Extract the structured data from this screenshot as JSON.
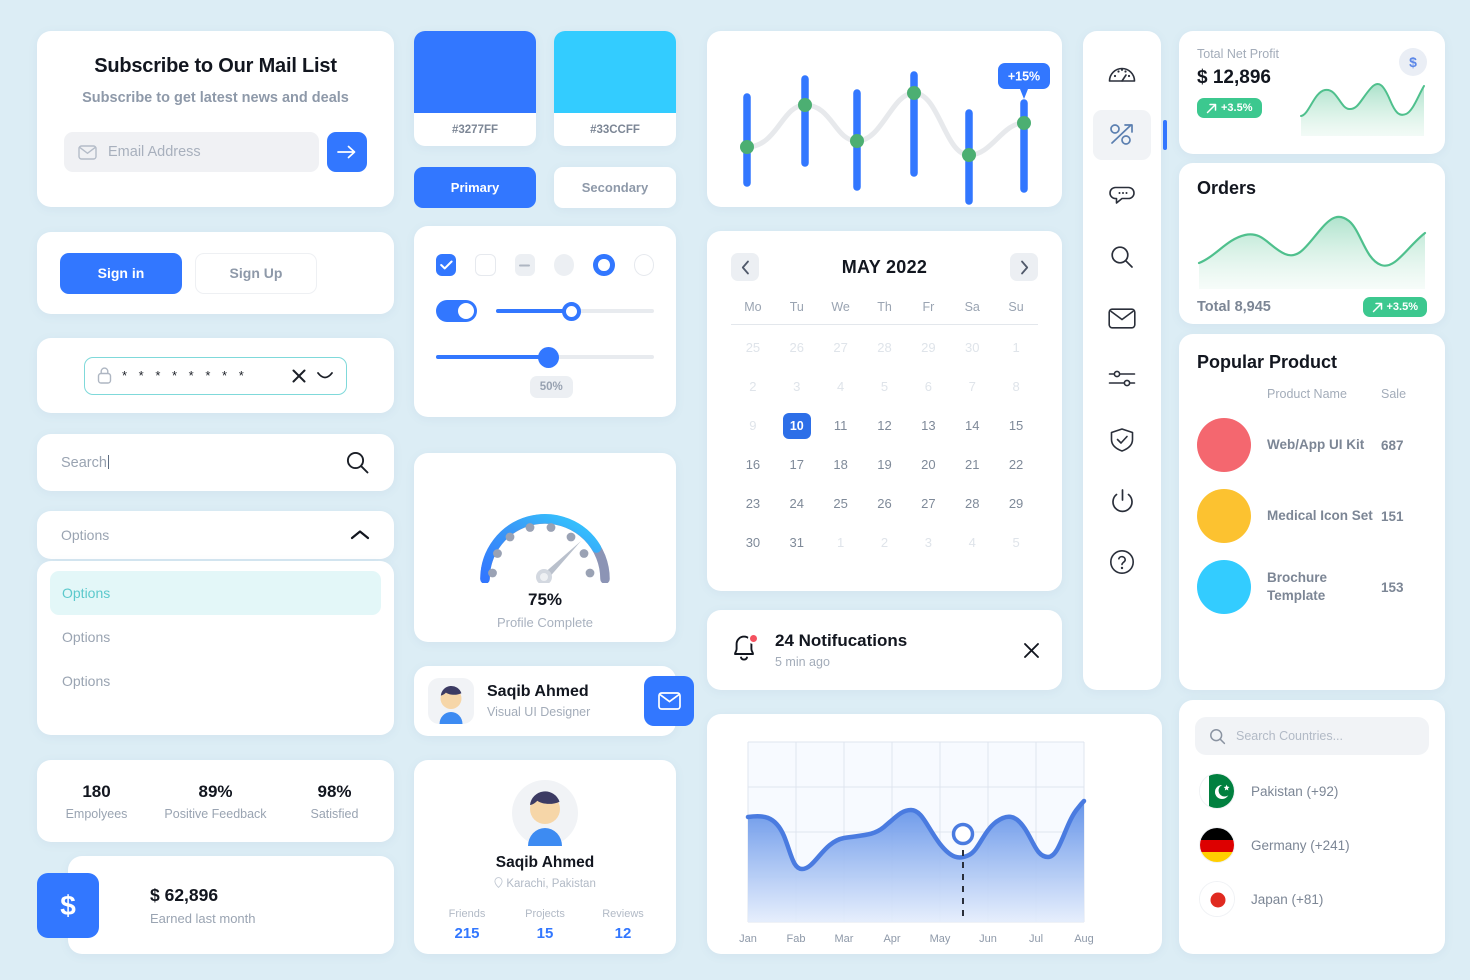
{
  "subscribe": {
    "title": "Subscribe to Our Mail List",
    "subtitle": "Subscribe to get latest news and deals",
    "email_placeholder": "Email Address",
    "submit_icon": "arrow-right-icon"
  },
  "auth": {
    "sign_in": "Sign in",
    "sign_up": "Sign Up"
  },
  "password": {
    "value": "* * * * * * * *",
    "clear_icon": "close-icon",
    "toggle_icon": "eye-icon"
  },
  "search": {
    "value": "Search",
    "icon": "search-icon"
  },
  "dropdown": {
    "label": "Options",
    "chevron": "chevron-up-icon",
    "items": [
      {
        "label": "Options",
        "selected": true
      },
      {
        "label": "Options",
        "selected": false
      },
      {
        "label": "Options",
        "selected": false
      }
    ]
  },
  "stats": [
    {
      "value": "180",
      "label": "Empolyees"
    },
    {
      "value": "89%",
      "label": "Positive Feedback"
    },
    {
      "value": "98%",
      "label": "Satisfied"
    }
  ],
  "earnings": {
    "icon": "dollar-icon",
    "symbol": "$",
    "value": "$ 62,896",
    "label": "Earned last month"
  },
  "swatches": [
    {
      "hex": "#3277FF",
      "label": "#3277FF"
    },
    {
      "hex": "#33CCFF",
      "label": "#33CCFF"
    }
  ],
  "tone_buttons": {
    "primary": "Primary",
    "secondary": "Secondary"
  },
  "controls": {
    "slider_tooltip": "50%",
    "slider_top_value": 50,
    "slider_bottom_value": 50
  },
  "gauge": {
    "percent": "75%",
    "label": "Profile Complete",
    "value": 75
  },
  "profile_row": {
    "name": "Saqib Ahmed",
    "role": "Visual UI Designer",
    "action_icon": "mail-icon"
  },
  "profile_big": {
    "name": "Saqib Ahmed",
    "location": "Karachi, Pakistan",
    "location_icon": "pin-icon",
    "stats": [
      {
        "label": "Friends",
        "value": "215"
      },
      {
        "label": "Projects",
        "value": "15"
      },
      {
        "label": "Reviews",
        "value": "12"
      }
    ]
  },
  "calendar": {
    "title": "MAY 2022",
    "prev_icon": "chevron-left-icon",
    "next_icon": "chevron-right-icon",
    "dow": [
      "Mo",
      "Tu",
      "We",
      "Th",
      "Fr",
      "Sa",
      "Su"
    ],
    "weeks": [
      [
        {
          "d": "25",
          "dim": true
        },
        {
          "d": "26",
          "dim": true
        },
        {
          "d": "27",
          "dim": true
        },
        {
          "d": "28",
          "dim": true
        },
        {
          "d": "29",
          "dim": true
        },
        {
          "d": "30",
          "dim": true
        },
        {
          "d": "1",
          "dim": true
        }
      ],
      [
        {
          "d": "2",
          "dim": true
        },
        {
          "d": "3",
          "dim": true
        },
        {
          "d": "4",
          "dim": true
        },
        {
          "d": "5",
          "dim": true
        },
        {
          "d": "6",
          "dim": true
        },
        {
          "d": "7",
          "dim": true
        },
        {
          "d": "8",
          "dim": true
        }
      ],
      [
        {
          "d": "9",
          "dim": true
        },
        {
          "d": "10",
          "sel": true
        },
        {
          "d": "11"
        },
        {
          "d": "12"
        },
        {
          "d": "13"
        },
        {
          "d": "14"
        },
        {
          "d": "15"
        }
      ],
      [
        {
          "d": "16"
        },
        {
          "d": "17"
        },
        {
          "d": "18"
        },
        {
          "d": "19"
        },
        {
          "d": "20"
        },
        {
          "d": "21"
        },
        {
          "d": "22"
        }
      ],
      [
        {
          "d": "23"
        },
        {
          "d": "24"
        },
        {
          "d": "25"
        },
        {
          "d": "26"
        },
        {
          "d": "27"
        },
        {
          "d": "28"
        },
        {
          "d": "29"
        }
      ],
      [
        {
          "d": "30"
        },
        {
          "d": "31"
        },
        {
          "d": "1",
          "dim": true
        },
        {
          "d": "2",
          "dim": true
        },
        {
          "d": "3",
          "dim": true
        },
        {
          "d": "4",
          "dim": true
        },
        {
          "d": "5",
          "dim": true
        }
      ]
    ],
    "selected_day": "10"
  },
  "notification": {
    "title": "24 Notifucations",
    "time": "5 min ago",
    "bell_icon": "bell-icon",
    "close_icon": "close-icon"
  },
  "rail": [
    {
      "icon": "speedometer-icon",
      "active": false
    },
    {
      "icon": "percent-trending-icon",
      "active": true
    },
    {
      "icon": "chat-bubble-icon",
      "active": false
    },
    {
      "icon": "search-icon",
      "active": false
    },
    {
      "icon": "mail-icon",
      "active": false
    },
    {
      "icon": "sliders-icon",
      "active": false
    },
    {
      "icon": "shield-check-icon",
      "active": false
    },
    {
      "icon": "power-icon",
      "active": false
    },
    {
      "icon": "help-circle-icon",
      "active": false
    }
  ],
  "profit": {
    "label": "Total Net Profit",
    "value": "$ 12,896",
    "delta": "+3.5%",
    "delta_icon": "trend-up-icon",
    "coin_symbol": "$"
  },
  "orders": {
    "title": "Orders",
    "total": "Total 8,945",
    "delta": "+3.5%",
    "delta_icon": "trend-up-icon"
  },
  "popular": {
    "title": "Popular Product",
    "col_name": "Product Name",
    "col_sale": "Sale",
    "rows": [
      {
        "name": "Web/App UI Kit",
        "sale": "687",
        "color": "#F4676F"
      },
      {
        "name": "Medical Icon Set",
        "sale": "151",
        "color": "#FCC230"
      },
      {
        "name": "Brochure Template",
        "sale": "153",
        "color": "#33CCFF"
      }
    ]
  },
  "countries": {
    "search_placeholder": "Search Countries...",
    "search_icon": "search-icon",
    "items": [
      {
        "name": "Pakistan (+92)",
        "flag": "pakistan-flag"
      },
      {
        "name": "Germany (+241)",
        "flag": "germany-flag"
      },
      {
        "name": "Japan (+81)",
        "flag": "japan-flag"
      }
    ]
  },
  "chart_data": [
    {
      "type": "line",
      "name": "candlestick-trend-chart",
      "title": "",
      "categories": [
        "1",
        "2",
        "3",
        "4",
        "5",
        "6",
        "7"
      ],
      "series": [
        {
          "name": "Close",
          "values": [
            28,
            62,
            42,
            72,
            30,
            58
          ]
        }
      ],
      "bars": [
        {
          "x": 1,
          "low": 14,
          "high": 62,
          "marker": 28
        },
        {
          "x": 2,
          "low": 26,
          "high": 82,
          "marker": 62
        },
        {
          "x": 3,
          "low": 12,
          "high": 70,
          "marker": 42
        },
        {
          "x": 4,
          "low": 28,
          "high": 88,
          "marker": 72
        },
        {
          "x": 5,
          "low": 4,
          "high": 56,
          "marker": 30
        },
        {
          "x": 6,
          "low": 18,
          "high": 78,
          "marker": 58
        }
      ],
      "annotation": "+15%",
      "grid": false,
      "legend": "none",
      "bar_color": "#3277FF",
      "marker_color": "#4CAF72",
      "line_color": "#E7E9EC"
    },
    {
      "type": "area",
      "name": "monthly-area-chart",
      "title": "",
      "xlabel": "",
      "ylabel": "",
      "categories": [
        "Jan",
        "Fab",
        "Mar",
        "Apr",
        "May",
        "Jun",
        "Jul",
        "Aug"
      ],
      "tick_labels": [
        "Jan",
        "Fab",
        "Mar",
        "Apr",
        "May",
        "Jun",
        "Jul",
        "Aug"
      ],
      "values": [
        63,
        26,
        50,
        66,
        42,
        64,
        36,
        76
      ],
      "ylim": [
        0,
        100
      ],
      "grid": true,
      "legend": "none",
      "marker_at": "May-Jun",
      "line_color": "#4A7BE0",
      "fill_top": "#5E8FE8",
      "fill_bottom": "#E4EDFC"
    },
    {
      "type": "area",
      "name": "net-profit-sparkline",
      "title": "Total Net Profit",
      "categories": [
        "1",
        "2",
        "3",
        "4",
        "5",
        "6",
        "7",
        "8"
      ],
      "values": [
        34,
        68,
        48,
        52,
        80,
        40,
        50,
        76
      ],
      "grid": false,
      "legend": "none",
      "line_color": "#4FC08D"
    },
    {
      "type": "area",
      "name": "orders-area-chart",
      "title": "Orders",
      "categories": [
        "1",
        "2",
        "3",
        "4",
        "5",
        "6",
        "7",
        "8"
      ],
      "values": [
        30,
        58,
        66,
        48,
        50,
        86,
        36,
        26,
        56,
        72
      ],
      "grid": false,
      "legend": "none",
      "line_color": "#4FC08D"
    },
    {
      "type": "gauge",
      "name": "profile-complete-gauge",
      "title": "Profile Complete",
      "value": 75,
      "min": 0,
      "max": 100,
      "unit": "%",
      "label": "75%"
    }
  ]
}
